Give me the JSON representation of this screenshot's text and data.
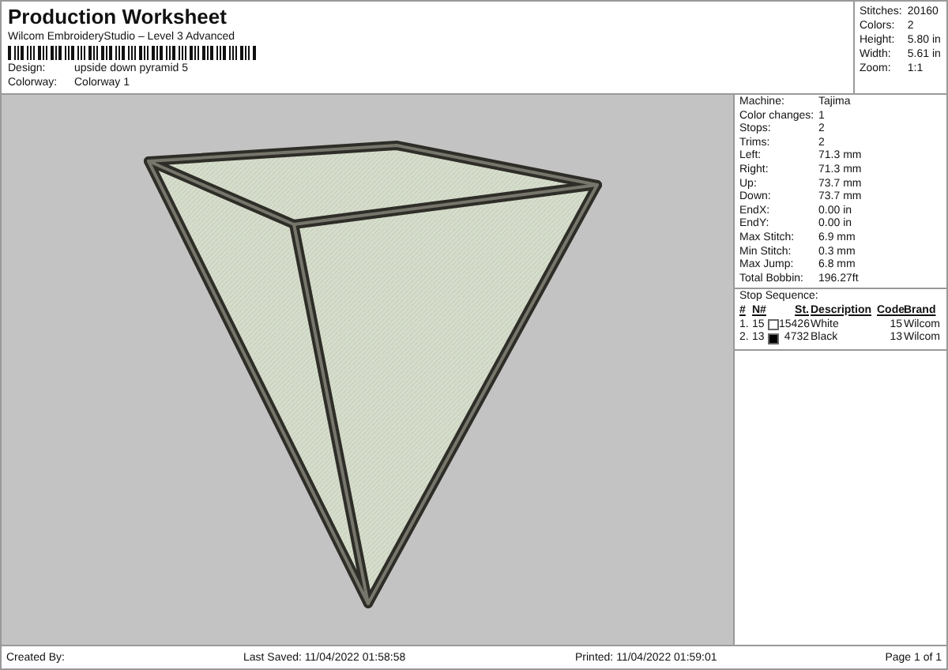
{
  "title": "Production Worksheet",
  "subtitle": "Wilcom EmbroideryStudio – Level 3 Advanced",
  "fields": [
    {
      "label": "Design:",
      "value": "upside down pyramid 5"
    },
    {
      "label": "Colorway:",
      "value": "Colorway 1"
    }
  ],
  "summary": [
    {
      "label": "Stitches:",
      "value": "20160"
    },
    {
      "label": "Colors:",
      "value": "2"
    },
    {
      "label": "Height:",
      "value": "5.80 in"
    },
    {
      "label": "Width:",
      "value": "5.61 in"
    },
    {
      "label": "Zoom:",
      "value": "1:1"
    }
  ],
  "details": [
    {
      "label": "Machine:",
      "value": "Tajima"
    },
    {
      "label": "Color changes:",
      "value": "1"
    },
    {
      "label": "Stops:",
      "value": "2"
    },
    {
      "label": "Trims:",
      "value": "2"
    },
    {
      "label": "Left:",
      "value": "71.3 mm"
    },
    {
      "label": "Right:",
      "value": "71.3 mm"
    },
    {
      "label": "Up:",
      "value": "73.7 mm"
    },
    {
      "label": "Down:",
      "value": "73.7 mm"
    },
    {
      "label": "EndX:",
      "value": "0.00 in"
    },
    {
      "label": "EndY:",
      "value": "0.00 in"
    },
    {
      "label": "Max Stitch:",
      "value": "6.9 mm"
    },
    {
      "label": "Min Stitch:",
      "value": "0.3 mm"
    },
    {
      "label": "Max Jump:",
      "value": "6.8 mm"
    },
    {
      "label": "Total Bobbin:",
      "value": "196.27ft"
    }
  ],
  "stop_sequence": {
    "title": "Stop Sequence:",
    "columns": [
      "#",
      "N#",
      "St.",
      "Description",
      "Code",
      "Brand"
    ],
    "rows": [
      {
        "index": "1.",
        "number": "15",
        "color": "#ffffff",
        "stitches": "15426",
        "description": "White",
        "code": "15",
        "brand": "Wilcom"
      },
      {
        "index": "2.",
        "number": "13",
        "color": "#000000",
        "stitches": "4732",
        "description": "Black",
        "code": "13",
        "brand": "Wilcom"
      }
    ]
  },
  "footer": {
    "created_by": "Created By:",
    "last_saved": "Last Saved: 11/04/2022 01:58:58",
    "printed": "Printed: 11/04/2022 01:59:01",
    "page": "Page 1 of 1"
  }
}
